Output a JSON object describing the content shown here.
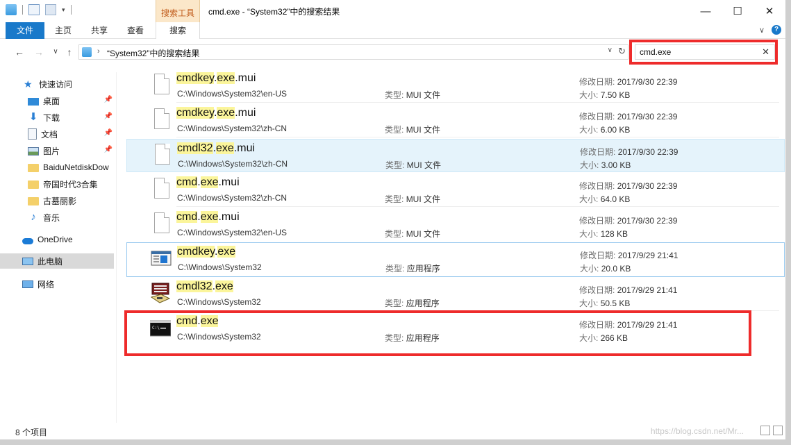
{
  "window": {
    "title": "cmd.exe - “System32”中的搜索结果",
    "context_tab_group": "搜索工具",
    "controls": {
      "minimize": "—",
      "maximize": "☐",
      "close": "✕"
    }
  },
  "ribbon": {
    "tabs": [
      {
        "label": "文件"
      },
      {
        "label": "主页"
      },
      {
        "label": "共享"
      },
      {
        "label": "查看"
      },
      {
        "label": "搜索"
      }
    ],
    "expand_glyph": "∨",
    "help_glyph": "?"
  },
  "address": {
    "back": "←",
    "forward": "→",
    "recent": "∨",
    "up": "↑",
    "crumb_sep": "›",
    "crumb": "“System32”中的搜索结果",
    "dropdown": "∨",
    "refresh": "↻"
  },
  "search": {
    "value": "cmd.exe",
    "clear": "✕"
  },
  "sidebar": {
    "items": [
      {
        "label": "快速访问",
        "icon": "star-icon"
      },
      {
        "label": "桌面",
        "icon": "desktop-icon",
        "pinned": true
      },
      {
        "label": "下载",
        "icon": "download-icon",
        "pinned": true
      },
      {
        "label": "文档",
        "icon": "document-icon",
        "pinned": true
      },
      {
        "label": "图片",
        "icon": "picture-icon",
        "pinned": true
      },
      {
        "label": "BaiduNetdiskDow",
        "icon": "folder-icon"
      },
      {
        "label": "帝国时代3合集",
        "icon": "folder-icon"
      },
      {
        "label": "古墓丽影",
        "icon": "folder-icon"
      },
      {
        "label": "音乐",
        "icon": "music-icon"
      },
      {
        "label": "OneDrive",
        "icon": "cloud-icon"
      },
      {
        "label": "此电脑",
        "icon": "computer-icon",
        "selected": true
      },
      {
        "label": "网络",
        "icon": "network-icon"
      }
    ],
    "pin_glyph": "📌"
  },
  "results": [
    {
      "name_pre": "cmdkey",
      "name_hl": "exe",
      "name_post": ".mui",
      "name_pre_dot": ".",
      "path": "C:\\Windows\\System32\\en-US",
      "type_label": "类型:",
      "type": "MUI 文件",
      "date_label": "修改日期:",
      "date": "2017/9/30 22:39",
      "size_label": "大小:",
      "size": "7.50 KB"
    },
    {
      "name_pre": "cmdkey",
      "name_hl": "exe",
      "name_post": ".mui",
      "name_pre_dot": ".",
      "path": "C:\\Windows\\System32\\zh-CN",
      "type_label": "类型:",
      "type": "MUI 文件",
      "date_label": "修改日期:",
      "date": "2017/9/30 22:39",
      "size_label": "大小:",
      "size": "6.00 KB"
    },
    {
      "name_pre": "cmdl32",
      "name_hl": "exe",
      "name_post": ".mui",
      "name_pre_dot": ".",
      "path": "C:\\Windows\\System32\\zh-CN",
      "type_label": "类型:",
      "type": "MUI 文件",
      "date_label": "修改日期:",
      "date": "2017/9/30 22:39",
      "size_label": "大小:",
      "size": "3.00 KB"
    },
    {
      "name_pre": "cmd",
      "name_hl": "exe",
      "name_post": ".mui",
      "name_pre_dot": ".",
      "path": "C:\\Windows\\System32\\zh-CN",
      "type_label": "类型:",
      "type": "MUI 文件",
      "date_label": "修改日期:",
      "date": "2017/9/30 22:39",
      "size_label": "大小:",
      "size": "64.0 KB"
    },
    {
      "name_pre": "cmd",
      "name_hl": "exe",
      "name_post": ".mui",
      "name_pre_dot": ".",
      "path": "C:\\Windows\\System32\\en-US",
      "type_label": "类型:",
      "type": "MUI 文件",
      "date_label": "修改日期:",
      "date": "2017/9/30 22:39",
      "size_label": "大小:",
      "size": "128 KB"
    },
    {
      "name_pre": "cmdkey",
      "name_hl": "exe",
      "name_post": "",
      "name_pre_dot": ".",
      "path": "C:\\Windows\\System32",
      "type_label": "类型:",
      "type": "应用程序",
      "date_label": "修改日期:",
      "date": "2017/9/29 21:41",
      "size_label": "大小:",
      "size": "20.0 KB"
    },
    {
      "name_pre": "cmdl32",
      "name_hl": "exe",
      "name_post": "",
      "name_pre_dot": ".",
      "path": "C:\\Windows\\System32",
      "type_label": "类型:",
      "type": "应用程序",
      "date_label": "修改日期:",
      "date": "2017/9/29 21:41",
      "size_label": "大小:",
      "size": "50.5 KB"
    },
    {
      "name_pre": "cmd",
      "name_hl": "exe",
      "name_post": "",
      "name_pre_dot": ".",
      "path": "C:\\Windows\\System32",
      "type_label": "类型:",
      "type": "应用程序",
      "date_label": "修改日期:",
      "date": "2017/9/29 21:41",
      "size_label": "大小:",
      "size": "266 KB"
    }
  ],
  "status": {
    "count": "8 个项目",
    "watermark": "https://blog.csdn.net/Mr..."
  },
  "colors": {
    "accent": "#1979ca",
    "highlight": "#fbf59b",
    "annotation_red": "#ee2b2b",
    "context_tab": "#fbe7c9"
  }
}
